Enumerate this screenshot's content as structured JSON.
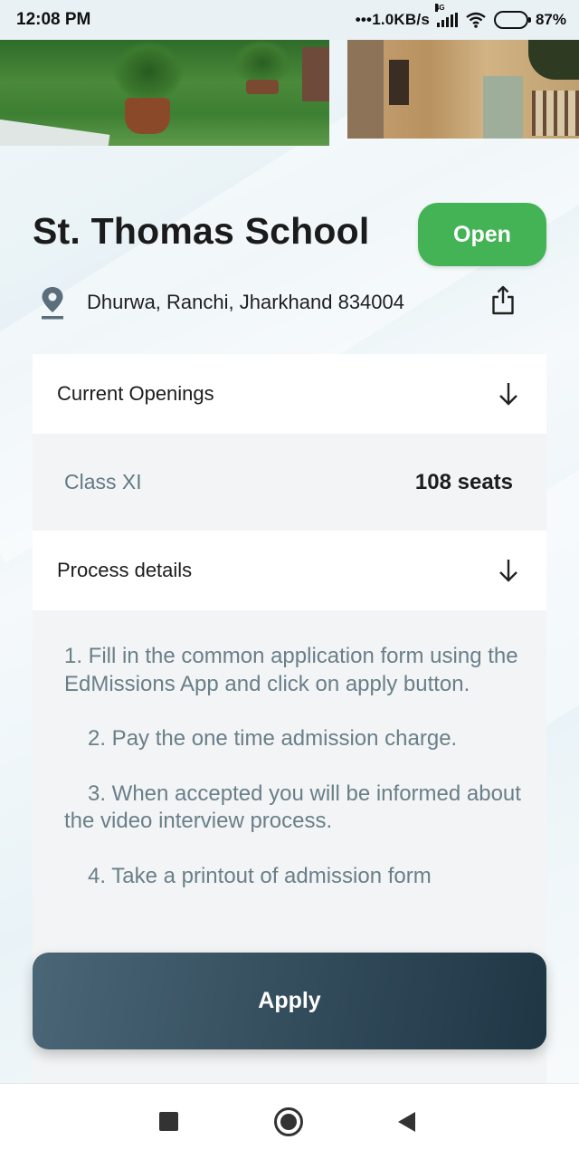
{
  "status_bar": {
    "time": "12:08 PM",
    "net_speed": "•••1.0KB/s",
    "network_type": "4G",
    "battery_percent": "87%",
    "battery_level": 0.87,
    "battery_color": "#f0a21a"
  },
  "school": {
    "name": "St. Thomas School",
    "status": "Open",
    "status_color": "#44b355",
    "address": "Dhurwa, Ranchi, Jharkhand 834004"
  },
  "openings": {
    "title": "Current Openings",
    "rows": [
      {
        "class": "Class XI",
        "seats": "108 seats"
      }
    ]
  },
  "process": {
    "title": "Process details",
    "steps": [
      "1. Fill in the common application form using the EdMissions App and click on apply button.",
      "2. Pay the one time admission charge.",
      "3. When accepted you will be informed about the video interview process.",
      "4. Take a printout of admission form"
    ]
  },
  "apply_label": "Apply",
  "icons": {
    "location": "location-pin-icon",
    "share": "share-icon",
    "expand": "arrow-down-icon",
    "nav_recent": "square-icon",
    "nav_home": "circle-icon",
    "nav_back": "triangle-back-icon"
  }
}
